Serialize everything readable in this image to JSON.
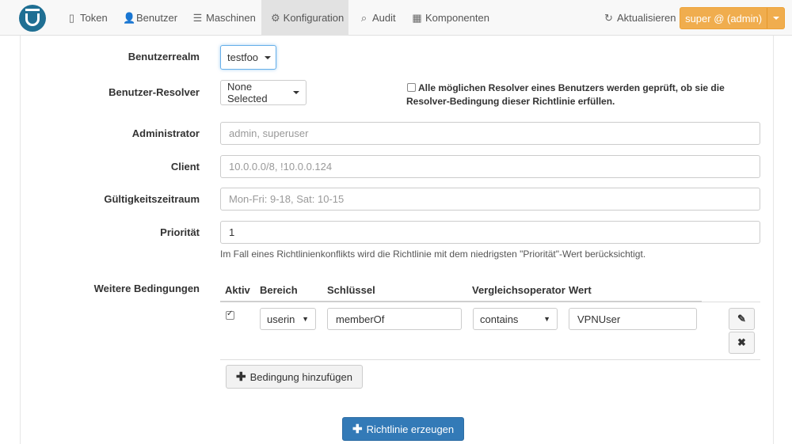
{
  "navbar": {
    "items": [
      {
        "label": "Token",
        "icon": "mobile-icon"
      },
      {
        "label": "Benutzer",
        "icon": "user-icon"
      },
      {
        "label": "Maschinen",
        "icon": "server-icon"
      },
      {
        "label": "Konfiguration",
        "icon": "wrench-icon"
      },
      {
        "label": "Audit",
        "icon": "search-icon"
      },
      {
        "label": "Komponenten",
        "icon": "table-icon"
      }
    ],
    "active": "Konfiguration",
    "refresh_label": "Aktualisieren",
    "user_label": "super @ (admin)"
  },
  "form": {
    "realm": {
      "label": "Benutzerrealm",
      "value": "testfoo"
    },
    "resolver": {
      "label": "Benutzer-Resolver",
      "value": "None Selected",
      "check_note": "Alle möglichen Resolver eines Benutzers werden geprüft, ob sie die Resolver-Bedingung dieser Richtlinie erfüllen."
    },
    "admin": {
      "label": "Administrator",
      "placeholder": "admin, superuser"
    },
    "client": {
      "label": "Client",
      "placeholder": "10.0.0.0/8, !10.0.0.124"
    },
    "validity": {
      "label": "Gültigkeitszeitraum",
      "placeholder": "Mon-Fri: 9-18, Sat: 10-15"
    },
    "priority": {
      "label": "Priorität",
      "value": "1",
      "help": "Im Fall eines Richtlinienkonflikts wird die Richtlinie mit dem niedrigsten \"Priorität\"-Wert berücksichtigt."
    }
  },
  "conditions": {
    "label": "Weitere Bedingungen",
    "headers": {
      "active": "Aktiv",
      "section": "Bereich",
      "key": "Schlüssel",
      "comparator": "Vergleichsoperator",
      "value": "Wert"
    },
    "rows": [
      {
        "active": true,
        "section": "userin",
        "key": "memberOf",
        "comparator": "contains",
        "value": "VPNUser"
      }
    ],
    "add_label": "Bedingung hinzufügen"
  },
  "submit_label": "Richtlinie erzeugen",
  "colors": {
    "primary": "#337ab7",
    "warning": "#f0ad4e",
    "logo": "#1f6f93"
  }
}
